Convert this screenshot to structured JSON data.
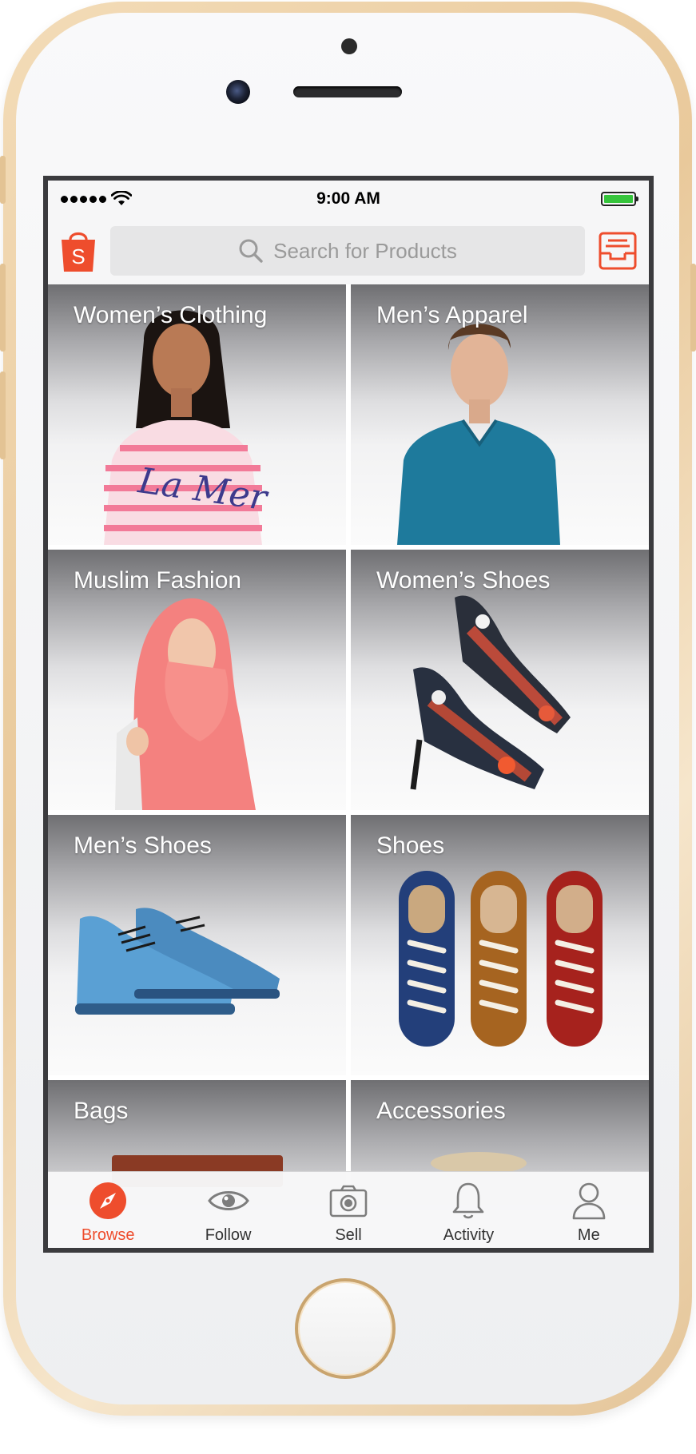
{
  "status_bar": {
    "time": "9:00 AM",
    "battery_color": "#35c43b"
  },
  "header": {
    "logo_icon": "shopee-bag-icon",
    "logo_letter": "S",
    "search_placeholder": "Search for Products",
    "inbox_icon": "inbox-tray-icon"
  },
  "colors": {
    "brand": "#ee4d2d",
    "tab_inactive": "#333333"
  },
  "categories": [
    {
      "label": "Women’s Clothing",
      "image": "woman-striped-tshirt"
    },
    {
      "label": "Men’s Apparel",
      "image": "man-blue-tshirt"
    },
    {
      "label": "Muslim Fashion",
      "image": "woman-pink-hijab"
    },
    {
      "label": "Women’s Shoes",
      "image": "floral-high-heels"
    },
    {
      "label": "Men’s Shoes",
      "image": "blue-brogue-shoes"
    },
    {
      "label": "Shoes",
      "image": "three-suede-sneakers"
    },
    {
      "label": "Bags",
      "image": "brown-bag"
    },
    {
      "label": "Accessories",
      "image": "straw-hat"
    }
  ],
  "tabs": [
    {
      "label": "Browse",
      "icon": "compass-icon",
      "active": true
    },
    {
      "label": "Follow",
      "icon": "eye-icon",
      "active": false
    },
    {
      "label": "Sell",
      "icon": "camera-icon",
      "active": false
    },
    {
      "label": "Activity",
      "icon": "bell-icon",
      "active": false
    },
    {
      "label": "Me",
      "icon": "person-icon",
      "active": false
    }
  ]
}
